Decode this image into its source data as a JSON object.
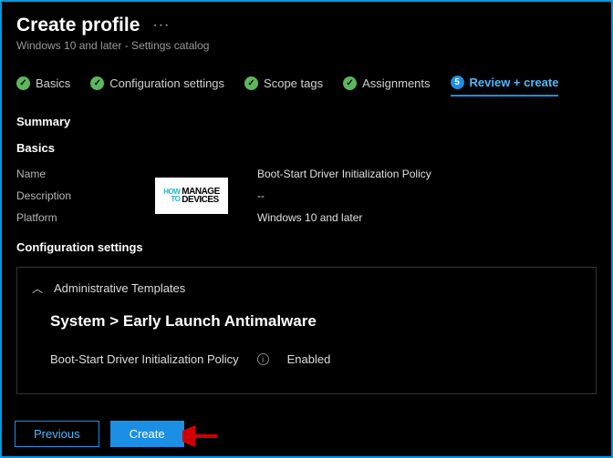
{
  "header": {
    "title": "Create profile",
    "subtitle": "Windows 10 and later - Settings catalog"
  },
  "steps": {
    "s1": "Basics",
    "s2": "Configuration settings",
    "s3": "Scope tags",
    "s4": "Assignments",
    "s5_num": "5",
    "s5": "Review + create"
  },
  "summary_label": "Summary",
  "basics": {
    "heading": "Basics",
    "name_label": "Name",
    "name_value": "Boot-Start Driver Initialization Policy",
    "desc_label": "Description",
    "desc_value": "--",
    "platform_label": "Platform",
    "platform_value": "Windows 10 and later"
  },
  "config": {
    "heading": "Configuration settings",
    "group": "Administrative Templates",
    "path": "System > Early Launch Antimalware",
    "setting_name": "Boot-Start Driver Initialization Policy",
    "setting_value": "Enabled"
  },
  "buttons": {
    "previous": "Previous",
    "create": "Create"
  },
  "watermark": {
    "l1": "HOW",
    "l2": "TO",
    "l3": "MANAGE",
    "l4": "DEVICES"
  }
}
